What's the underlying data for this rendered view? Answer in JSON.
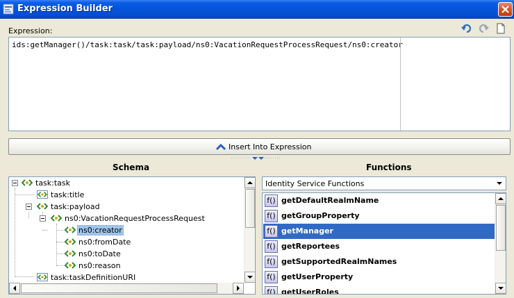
{
  "window": {
    "title": "Expression Builder"
  },
  "expression": {
    "label": "Expression:",
    "value": "ids:getManager()/task:task/task:payload/ns0:VacationRequestProcessRequest/ns0:creator"
  },
  "toolbar": {
    "icons": [
      "undo-icon",
      "redo-icon",
      "clear-document-icon"
    ]
  },
  "insert_button": {
    "label": "Insert Into Expression"
  },
  "schema": {
    "heading": "Schema",
    "items": [
      {
        "label": "task:task",
        "level": 0,
        "expander": true,
        "selected": false
      },
      {
        "label": "task:title",
        "level": 1,
        "expander": false,
        "selected": false
      },
      {
        "label": "task:payload",
        "level": 1,
        "expander": true,
        "selected": false
      },
      {
        "label": "ns0:VacationRequestProcessRequest",
        "level": 2,
        "expander": true,
        "selected": false
      },
      {
        "label": "ns0:creator",
        "level": 3,
        "expander": false,
        "selected": true
      },
      {
        "label": "ns0:fromDate",
        "level": 3,
        "expander": false,
        "selected": false
      },
      {
        "label": "ns0:toDate",
        "level": 3,
        "expander": false,
        "selected": false
      },
      {
        "label": "ns0:reason",
        "level": 3,
        "expander": false,
        "selected": false
      },
      {
        "label": "task:taskDefinitionURI",
        "level": 1,
        "expander": false,
        "selected": false
      }
    ]
  },
  "functions": {
    "heading": "Functions",
    "category": "Identity Service Functions",
    "icon_text": "f()",
    "items": [
      {
        "label": "getDefaultRealmName",
        "selected": false
      },
      {
        "label": "getGroupProperty",
        "selected": false
      },
      {
        "label": "getManager",
        "selected": true
      },
      {
        "label": "getReportees",
        "selected": false
      },
      {
        "label": "getSupportedRealmNames",
        "selected": false
      },
      {
        "label": "getUserProperty",
        "selected": false
      },
      {
        "label": "getUserRoles",
        "selected": false
      }
    ]
  },
  "colors": {
    "titlebar": "#0453d9",
    "selection": "#316ac5",
    "tree_selection": "#9ec5ec",
    "dialog_bg": "#ece9d8"
  }
}
